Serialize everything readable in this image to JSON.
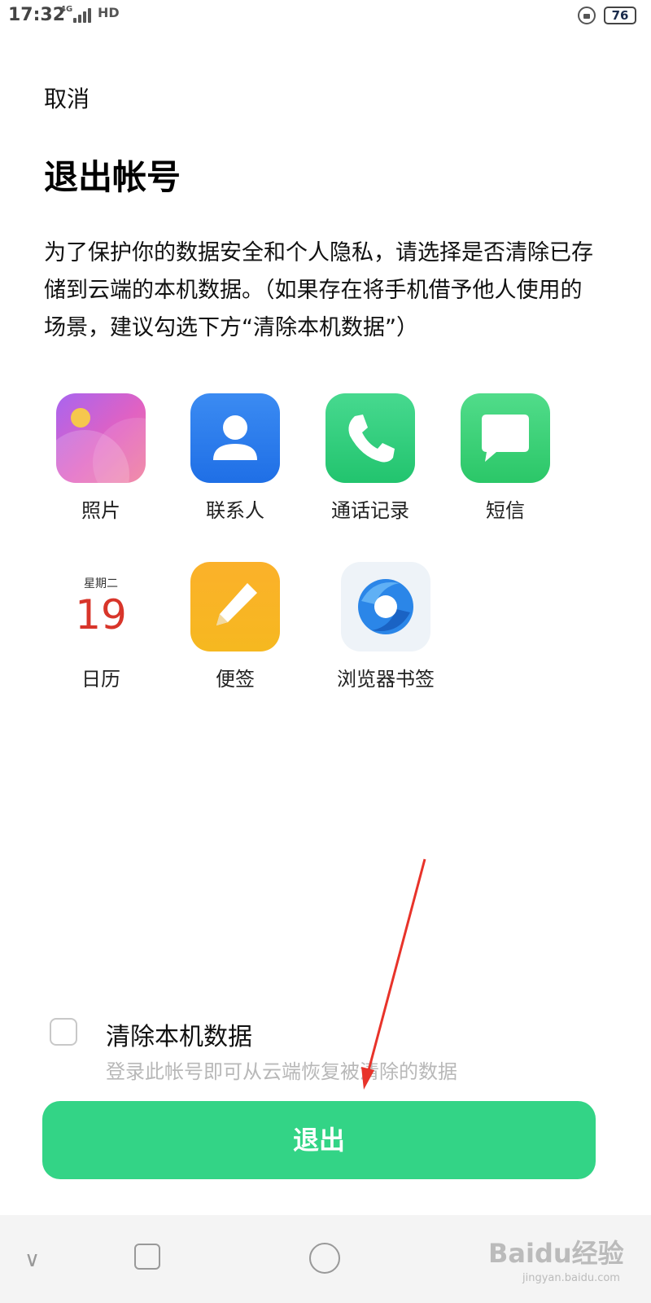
{
  "status_bar": {
    "time": "17:32",
    "signal_label": "4G",
    "hd_label": "HD",
    "battery": "76"
  },
  "header": {
    "cancel_label": "取消",
    "title": "退出帐号"
  },
  "description": "为了保护你的数据安全和个人隐私，请选择是否清除已存储到云端的本机数据。（如果存在将手机借予他人使用的场景，建议勾选下方“清除本机数据”）",
  "apps": [
    {
      "label": "照片",
      "icon": "photos-icon"
    },
    {
      "label": "联系人",
      "icon": "contacts-icon"
    },
    {
      "label": "通话记录",
      "icon": "phone-icon"
    },
    {
      "label": "短信",
      "icon": "sms-icon"
    },
    {
      "label": "日历",
      "icon": "calendar-icon",
      "weekday": "星期二",
      "day": "19"
    },
    {
      "label": "便签",
      "icon": "notes-icon"
    },
    {
      "label": "浏览器书签",
      "icon": "browser-icon"
    }
  ],
  "clear_option": {
    "label": "清除本机数据",
    "hint": "登录此帐号即可从云端恢复被清除的数据",
    "checked": false
  },
  "logout_button_label": "退出",
  "watermark": {
    "text": "Baidu经验",
    "sub": "jingyan.baidu.com"
  },
  "colors": {
    "accent": "#33d486",
    "annotation_arrow": "#e8332a"
  }
}
